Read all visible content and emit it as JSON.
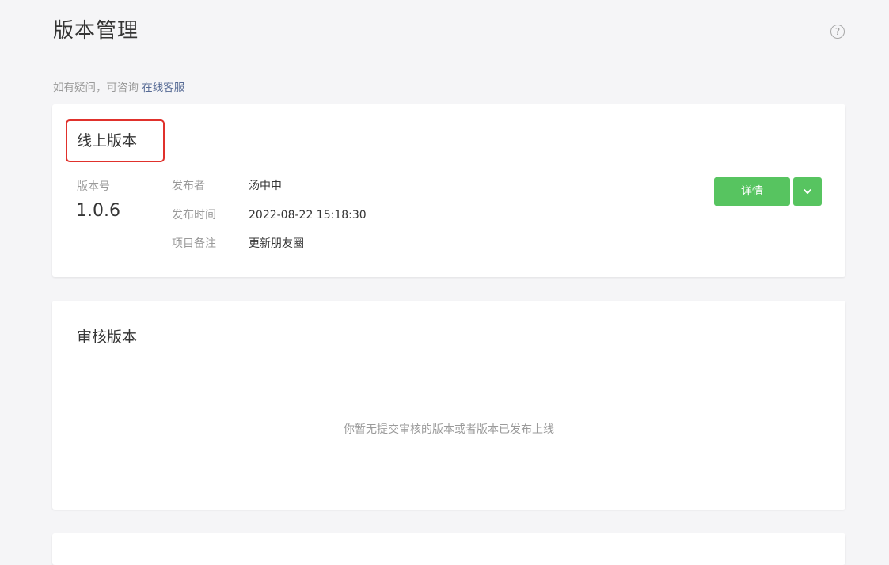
{
  "header": {
    "title": "版本管理",
    "help_icon": "question-circle-icon",
    "help_glyph": "?"
  },
  "consult": {
    "prefix": "如有疑问，可咨询 ",
    "link": "在线客服"
  },
  "online": {
    "title": "线上版本",
    "version_label": "版本号",
    "version_number": "1.0.6",
    "publisher_key": "发布者",
    "publisher_value": "汤中申",
    "time_key": "发布时间",
    "time_value": "2022-08-22 15:18:30",
    "note_key": "项目备注",
    "note_value": "更新朋友圈",
    "detail_button": "详情",
    "dropdown_icon": "chevron-down-icon"
  },
  "review": {
    "title": "审核版本",
    "empty_text": "你暂无提交审核的版本或者版本已发布上线"
  },
  "colors": {
    "accent_green": "#57c460",
    "link_blue": "#576b95",
    "highlight_red": "#e0312c",
    "page_bg": "#f5f5f7"
  }
}
